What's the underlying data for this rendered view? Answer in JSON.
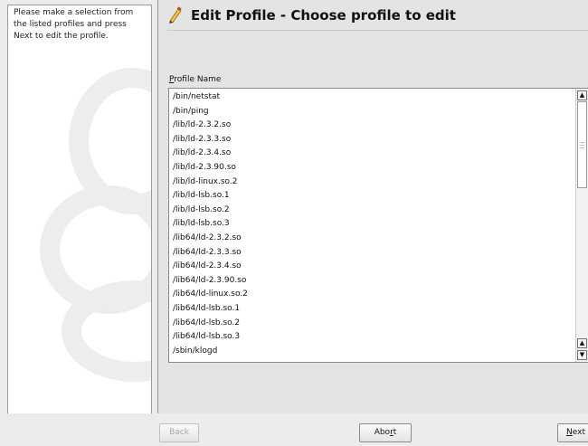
{
  "help": {
    "text": "Please make a selection from the listed profiles and press Next to edit the profile."
  },
  "header": {
    "title": "Edit Profile - Choose profile to edit"
  },
  "profile_list": {
    "label_mnemonic": "P",
    "label_rest": "rofile Name",
    "items": [
      "/bin/netstat",
      "/bin/ping",
      "/lib/ld-2.3.2.so",
      "/lib/ld-2.3.3.so",
      "/lib/ld-2.3.4.so",
      "/lib/ld-2.3.90.so",
      "/lib/ld-linux.so.2",
      "/lib/ld-lsb.so.1",
      "/lib/ld-lsb.so.2",
      "/lib/ld-lsb.so.3",
      "/lib64/ld-2.3.2.so",
      "/lib64/ld-2.3.3.so",
      "/lib64/ld-2.3.4.so",
      "/lib64/ld-2.3.90.so",
      "/lib64/ld-linux.so.2",
      "/lib64/ld-lsb.so.1",
      "/lib64/ld-lsb.so.2",
      "/lib64/ld-lsb.so.3",
      "/sbin/klogd"
    ]
  },
  "buttons": {
    "back": "Back",
    "abort_pre": "Abo",
    "abort_mnemonic": "r",
    "abort_post": "t",
    "next_mnemonic": "N",
    "next_rest": "ext"
  },
  "icons": {
    "header": "edit-profile-icon",
    "scroll_up": "arrow-up-icon",
    "scroll_down": "arrow-down-icon"
  }
}
